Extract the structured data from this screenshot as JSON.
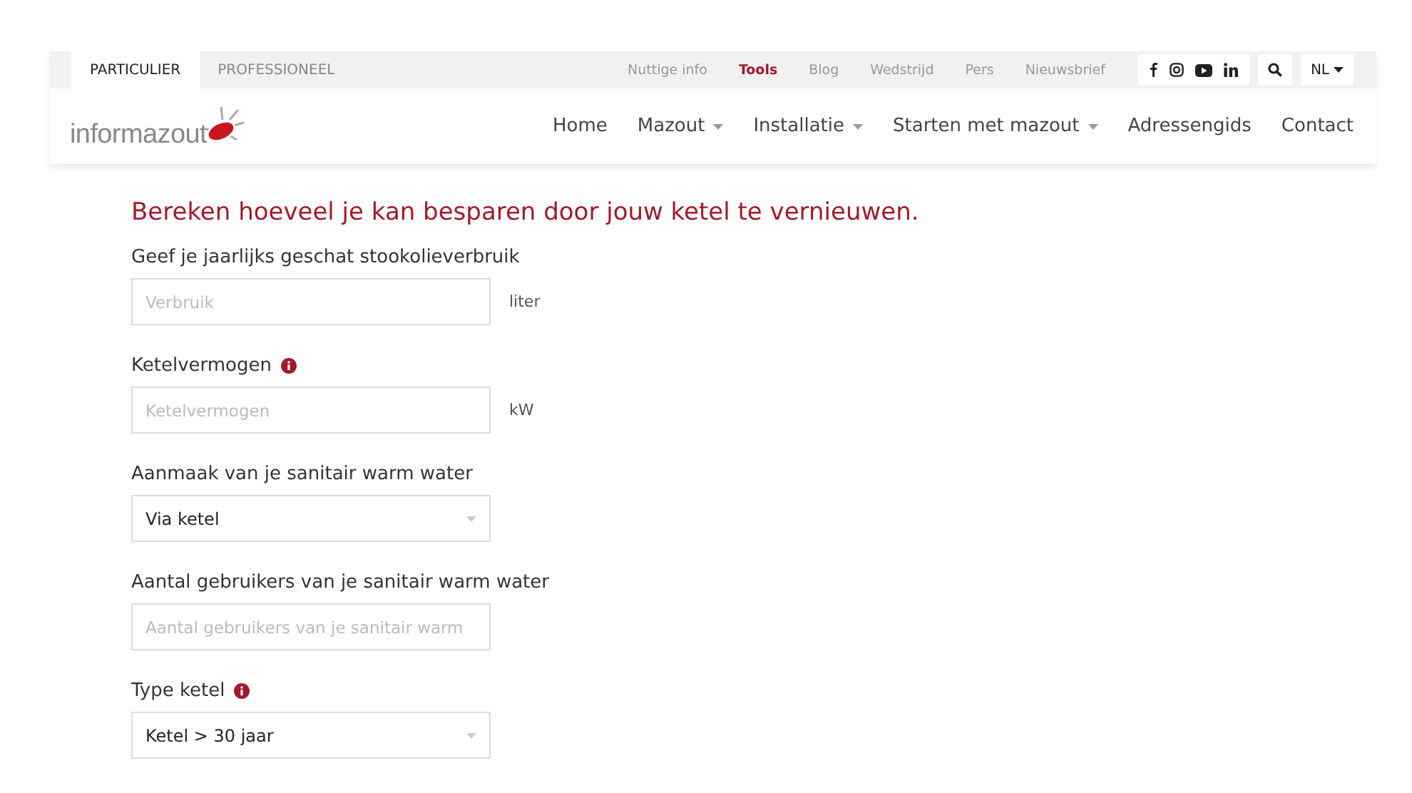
{
  "audience_tabs": [
    {
      "label": "PARTICULIER",
      "selected": true
    },
    {
      "label": "PROFESSIONEEL",
      "selected": false
    }
  ],
  "utility_links": [
    {
      "label": "Nuttige info",
      "selected": false
    },
    {
      "label": "Tools",
      "selected": true
    },
    {
      "label": "Blog",
      "selected": false
    },
    {
      "label": "Wedstrijd",
      "selected": false
    },
    {
      "label": "Pers",
      "selected": false
    },
    {
      "label": "Nieuwsbrief",
      "selected": false
    }
  ],
  "language": "NL",
  "logo": "informazout",
  "main_nav": [
    {
      "label": "Home",
      "dropdown": false
    },
    {
      "label": "Mazout",
      "dropdown": true
    },
    {
      "label": "Installatie",
      "dropdown": true
    },
    {
      "label": "Starten met mazout",
      "dropdown": true
    },
    {
      "label": "Adressengids",
      "dropdown": false
    },
    {
      "label": "Contact",
      "dropdown": false
    }
  ],
  "heading": "Bereken hoeveel je kan besparen door jouw ketel te vernieuwen.",
  "fields": [
    {
      "label": "Geef je jaarlijks geschat stookolieverbruik",
      "kind": "text",
      "placeholder": "Verbruik",
      "unit": "liter",
      "info": false
    },
    {
      "label": "Ketelvermogen",
      "kind": "text",
      "placeholder": "Ketelvermogen",
      "unit": "kW",
      "info": true
    },
    {
      "label": "Aanmaak van je sanitair warm water",
      "kind": "select",
      "value": "Via ketel",
      "info": false
    },
    {
      "label": "Aantal gebruikers van je sanitair warm water",
      "kind": "text",
      "placeholder": "Aantal gebruikers van je sanitair warm",
      "info": false
    },
    {
      "label": "Type ketel",
      "kind": "select",
      "value": "Ketel > 30 jaar",
      "info": true
    }
  ]
}
